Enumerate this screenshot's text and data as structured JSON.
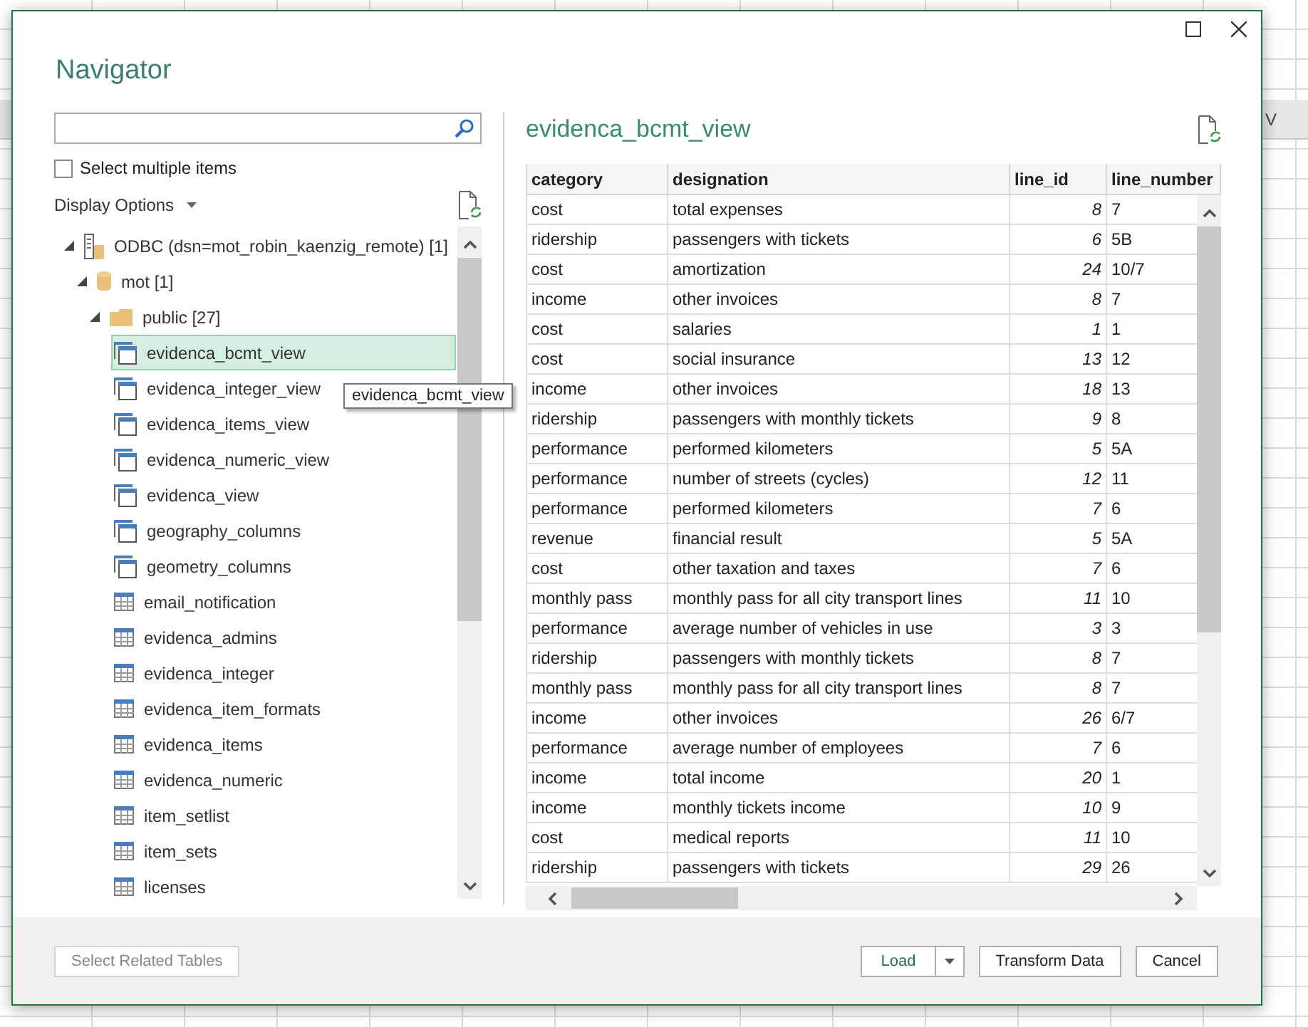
{
  "sheet": {
    "column_header": "V"
  },
  "window": {
    "title": "Navigator"
  },
  "select_multiple": {
    "label": "Select multiple items",
    "checked": false
  },
  "display_options": {
    "label": "Display Options"
  },
  "tree": [
    {
      "label": "ODBC (dsn=mot_robin_kaenzig_remote) [1]",
      "kind": "server",
      "expanded": true,
      "selected": false,
      "children": [
        {
          "label": "mot [1]",
          "kind": "database",
          "expanded": true,
          "selected": false,
          "children": [
            {
              "label": "public [27]",
              "kind": "schema",
              "expanded": true,
              "selected": false,
              "children": [
                {
                  "label": "evidenca_bcmt_view",
                  "kind": "view",
                  "selected": true
                },
                {
                  "label": "evidenca_integer_view",
                  "kind": "view",
                  "selected": false
                },
                {
                  "label": "evidenca_items_view",
                  "kind": "view",
                  "selected": false
                },
                {
                  "label": "evidenca_numeric_view",
                  "kind": "view",
                  "selected": false
                },
                {
                  "label": "evidenca_view",
                  "kind": "view",
                  "selected": false
                },
                {
                  "label": "geography_columns",
                  "kind": "view",
                  "selected": false
                },
                {
                  "label": "geometry_columns",
                  "kind": "view",
                  "selected": false
                },
                {
                  "label": "email_notification",
                  "kind": "table",
                  "selected": false
                },
                {
                  "label": "evidenca_admins",
                  "kind": "table",
                  "selected": false
                },
                {
                  "label": "evidenca_integer",
                  "kind": "table",
                  "selected": false
                },
                {
                  "label": "evidenca_item_formats",
                  "kind": "table",
                  "selected": false
                },
                {
                  "label": "evidenca_items",
                  "kind": "table",
                  "selected": false
                },
                {
                  "label": "evidenca_numeric",
                  "kind": "table",
                  "selected": false
                },
                {
                  "label": "item_setlist",
                  "kind": "table",
                  "selected": false
                },
                {
                  "label": "item_sets",
                  "kind": "table",
                  "selected": false
                },
                {
                  "label": "licenses",
                  "kind": "table",
                  "selected": false
                }
              ]
            }
          ]
        }
      ]
    }
  ],
  "tooltip": {
    "text": "evidenca_bcmt_view"
  },
  "preview": {
    "title": "evidenca_bcmt_view",
    "columns": [
      {
        "label": "category",
        "kind": "text"
      },
      {
        "label": "designation",
        "kind": "text"
      },
      {
        "label": "line_id",
        "kind": "number"
      },
      {
        "label": "line_number",
        "kind": "text"
      }
    ],
    "rows": [
      [
        "cost",
        "total expenses",
        "8",
        "7"
      ],
      [
        "ridership",
        "passengers with tickets",
        "6",
        "5B"
      ],
      [
        "cost",
        "amortization",
        "24",
        "10/7"
      ],
      [
        "income",
        "other invoices",
        "8",
        "7"
      ],
      [
        "cost",
        "salaries",
        "1",
        "1"
      ],
      [
        "cost",
        "social insurance",
        "13",
        "12"
      ],
      [
        "income",
        "other invoices",
        "18",
        "13"
      ],
      [
        "ridership",
        "passengers with monthly tickets",
        "9",
        "8"
      ],
      [
        "performance",
        "performed kilometers",
        "5",
        "5A"
      ],
      [
        "performance",
        "number of streets (cycles)",
        "12",
        "11"
      ],
      [
        "performance",
        "performed kilometers",
        "7",
        "6"
      ],
      [
        "revenue",
        "financial result",
        "5",
        "5A"
      ],
      [
        "cost",
        "other taxation and taxes",
        "7",
        "6"
      ],
      [
        "monthly pass",
        "monthly pass for all city transport lines",
        "11",
        "10"
      ],
      [
        "performance",
        "average number of vehicles in use",
        "3",
        "3"
      ],
      [
        "ridership",
        "passengers with monthly tickets",
        "8",
        "7"
      ],
      [
        "monthly pass",
        "monthly pass for all city transport lines",
        "8",
        "7"
      ],
      [
        "income",
        "other invoices",
        "26",
        "6/7"
      ],
      [
        "performance",
        "average number of employees",
        "7",
        "6"
      ],
      [
        "income",
        "total income",
        "20",
        "1"
      ],
      [
        "income",
        "monthly tickets income",
        "10",
        "9"
      ],
      [
        "cost",
        "medical reports",
        "11",
        "10"
      ],
      [
        "ridership",
        "passengers with tickets",
        "29",
        "26"
      ]
    ]
  },
  "footer": {
    "related": {
      "label": "Select Related Tables",
      "disabled": true
    },
    "buttons": [
      {
        "label": "Load",
        "kind": "split"
      },
      {
        "label": "Transform Data",
        "kind": "plain"
      },
      {
        "label": "Cancel",
        "kind": "plain"
      }
    ]
  }
}
